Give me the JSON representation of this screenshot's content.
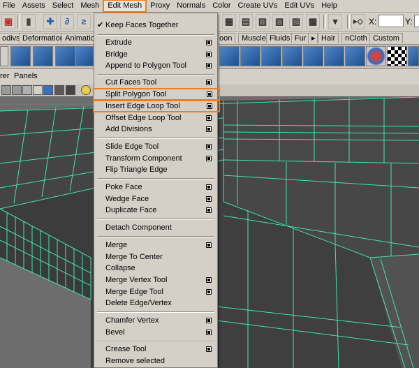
{
  "menubar": {
    "items": [
      {
        "label": "File"
      },
      {
        "label": "Assets"
      },
      {
        "label": "Select"
      },
      {
        "label": "Mesh"
      },
      {
        "label": "Edit Mesh",
        "active": true
      },
      {
        "label": "Proxy"
      },
      {
        "label": "Normals"
      },
      {
        "label": "Color"
      },
      {
        "label": "Create UVs"
      },
      {
        "label": "Edit UVs"
      },
      {
        "label": "Help"
      }
    ]
  },
  "statusline": {
    "x_label": "X:",
    "y_label": "Y:",
    "x_value": "",
    "y_value": ""
  },
  "shelf_tabs": [
    {
      "label": "odivs"
    },
    {
      "label": "Deformation"
    },
    {
      "label": "Animation"
    },
    {
      "label": "oon"
    },
    {
      "label": "Muscle"
    },
    {
      "label": "Fluids"
    },
    {
      "label": "Fur"
    },
    {
      "label": "Hair"
    },
    {
      "label": "nCloth"
    },
    {
      "label": "Custom"
    }
  ],
  "panel_menu": {
    "items": [
      {
        "label": "rer"
      },
      {
        "label": "Panels"
      }
    ]
  },
  "dropdown": {
    "items": [
      {
        "label": "Keep Faces Together",
        "checked": true,
        "option": false,
        "highlighted": false
      },
      {
        "label": "Extrude",
        "checked": false,
        "option": true,
        "highlighted": false
      },
      {
        "label": "Bridge",
        "checked": false,
        "option": true,
        "highlighted": false
      },
      {
        "label": "Append to Polygon Tool",
        "checked": false,
        "option": true,
        "highlighted": false
      },
      {
        "label": "Cut Faces Tool",
        "checked": false,
        "option": true,
        "highlighted": false
      },
      {
        "label": "Split Polygon Tool",
        "checked": false,
        "option": true,
        "highlighted": true
      },
      {
        "label": "Insert Edge Loop Tool",
        "checked": false,
        "option": true,
        "highlighted": true
      },
      {
        "label": "Offset Edge Loop Tool",
        "checked": false,
        "option": true,
        "highlighted": false
      },
      {
        "label": "Add Divisions",
        "checked": false,
        "option": true,
        "highlighted": false
      },
      {
        "label": "Slide Edge Tool",
        "checked": false,
        "option": true,
        "highlighted": false
      },
      {
        "label": "Transform Component",
        "checked": false,
        "option": true,
        "highlighted": false
      },
      {
        "label": "Flip Triangle Edge",
        "checked": false,
        "option": false,
        "highlighted": false
      },
      {
        "label": "Poke Face",
        "checked": false,
        "option": true,
        "highlighted": false
      },
      {
        "label": "Wedge Face",
        "checked": false,
        "option": true,
        "highlighted": false
      },
      {
        "label": "Duplicate Face",
        "checked": false,
        "option": true,
        "highlighted": false
      },
      {
        "label": "Detach Component",
        "checked": false,
        "option": false,
        "highlighted": false
      },
      {
        "label": "Merge",
        "checked": false,
        "option": true,
        "highlighted": false
      },
      {
        "label": "Merge To Center",
        "checked": false,
        "option": false,
        "highlighted": false
      },
      {
        "label": "Collapse",
        "checked": false,
        "option": false,
        "highlighted": false
      },
      {
        "label": "Merge Vertex Tool",
        "checked": false,
        "option": true,
        "highlighted": false
      },
      {
        "label": "Merge Edge Tool",
        "checked": false,
        "option": true,
        "highlighted": false
      },
      {
        "label": "Delete Edge/Vertex",
        "checked": false,
        "option": false,
        "highlighted": false
      },
      {
        "label": "Chamfer Vertex",
        "checked": false,
        "option": true,
        "highlighted": false
      },
      {
        "label": "Bevel",
        "checked": false,
        "option": true,
        "highlighted": false
      },
      {
        "label": "Crease Tool",
        "checked": false,
        "option": true,
        "highlighted": false
      },
      {
        "label": "Remove selected",
        "checked": false,
        "option": false,
        "highlighted": false
      }
    ]
  },
  "colors": {
    "menu_bg": "#d4d0c8",
    "highlight": "#f07d1e",
    "wireframe": "#3ee6b0",
    "viewport_bg": "#6d6d6d"
  }
}
